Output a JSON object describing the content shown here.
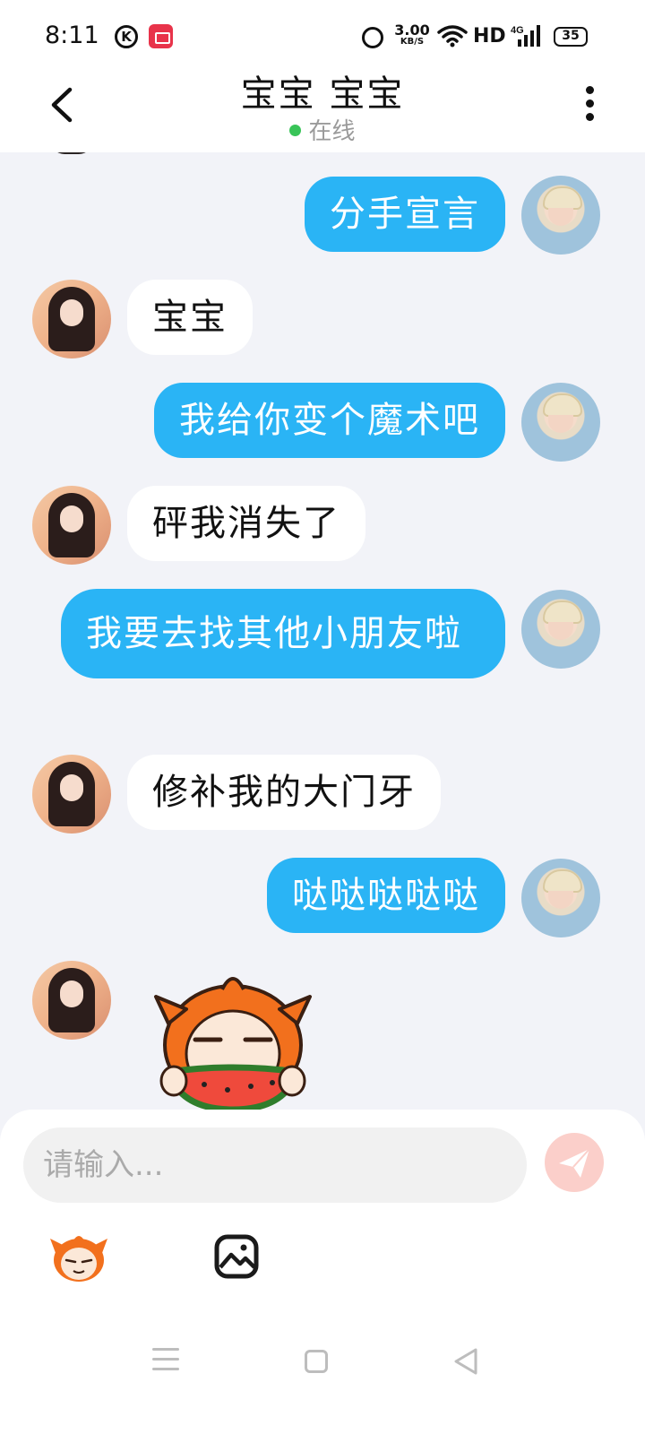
{
  "status_bar": {
    "time": "8:11",
    "k_badge": "K",
    "net_speed_value": "3.00",
    "net_speed_unit": "KB/S",
    "hd": "HD",
    "signal": "4G",
    "battery": "35"
  },
  "header": {
    "title": "宝宝 宝宝",
    "status": "在线",
    "status_color": "#38c458"
  },
  "messages": [
    {
      "side": "out",
      "text": "分手宣言"
    },
    {
      "side": "in",
      "text": "宝宝"
    },
    {
      "side": "out",
      "text": "我给你变个魔术吧"
    },
    {
      "side": "in",
      "text": "砰我消失了"
    },
    {
      "side": "out",
      "text": "我要去找其他小朋友啦"
    },
    {
      "side": "in",
      "text": "修补我的大门牙"
    },
    {
      "side": "out",
      "text": "哒哒哒哒哒"
    },
    {
      "side": "in",
      "type": "sticker",
      "icon": "watermelon-sticker"
    }
  ],
  "input": {
    "placeholder": "请输入...",
    "value": ""
  },
  "toolbar": {
    "emoji_icon": "emoji-sticker-icon",
    "image_icon": "image-icon"
  },
  "colors": {
    "outgoing_bubble": "#2ab4f5",
    "incoming_bubble": "#ffffff",
    "send_button": "#fbcfca",
    "background": "#f2f3f8"
  }
}
